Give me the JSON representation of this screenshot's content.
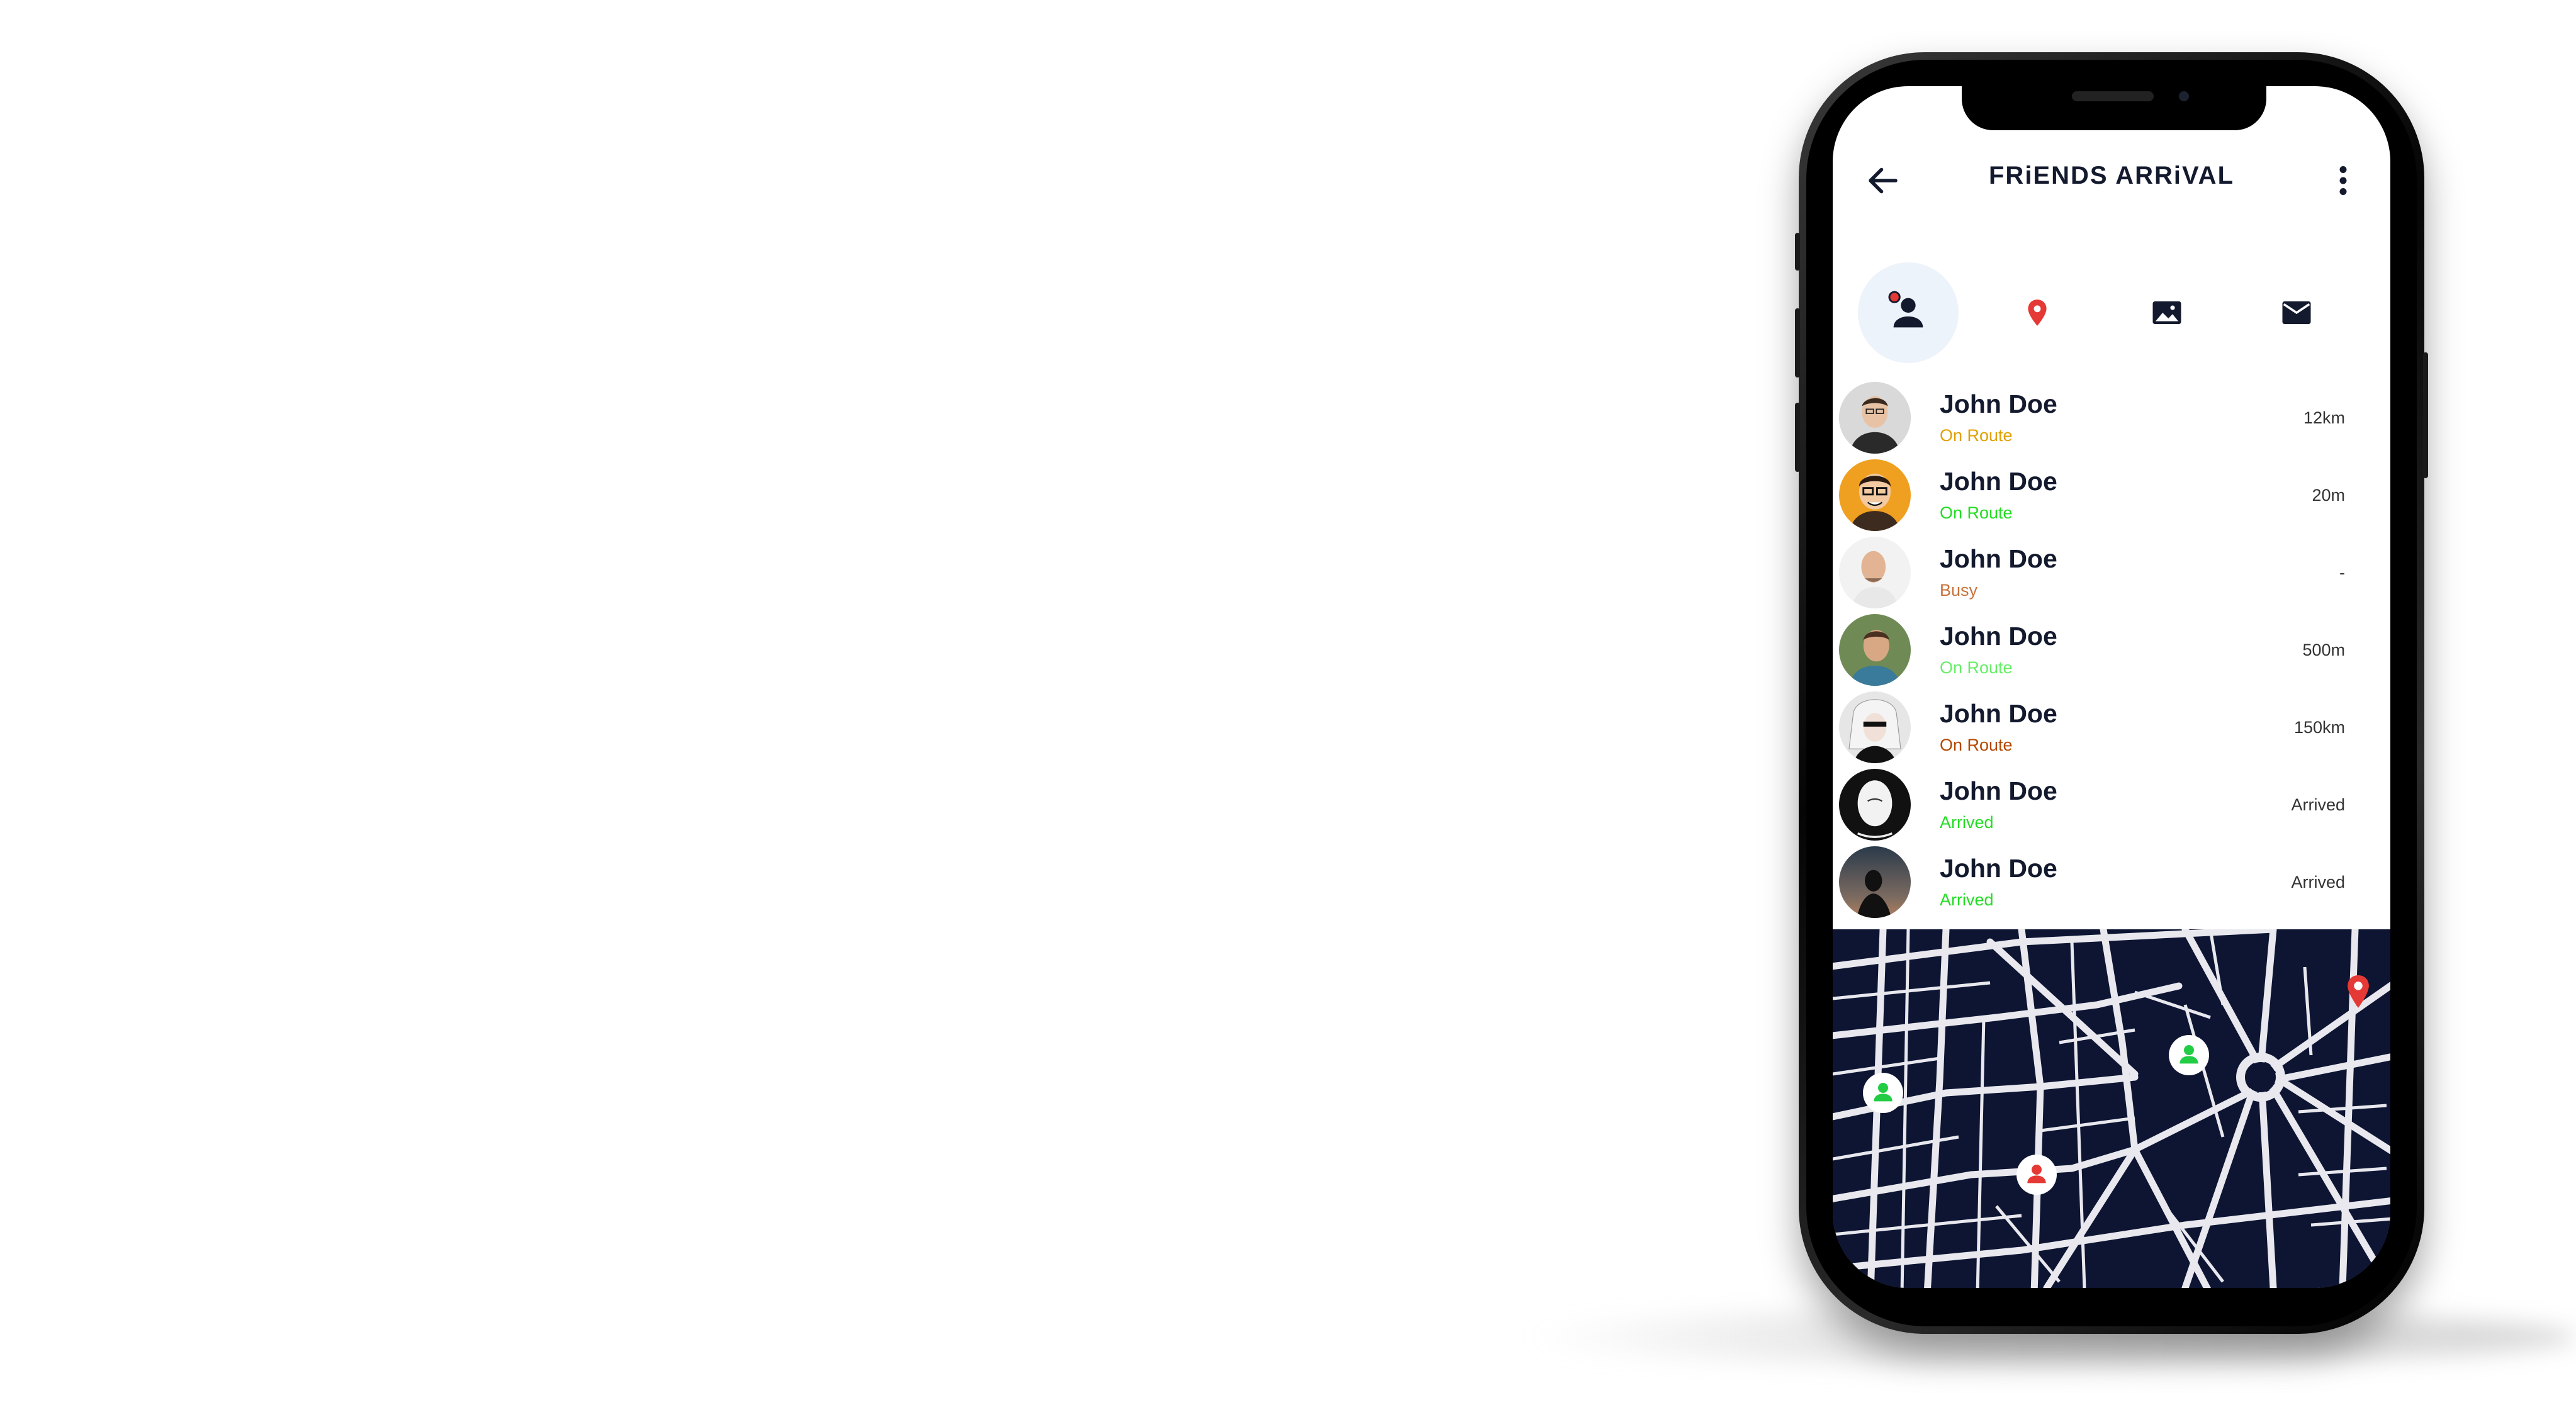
{
  "app": {
    "title": "FRiENDS ARRiVAL",
    "accent_color": "#e53935",
    "text_color": "#141a2e"
  },
  "header": {
    "back_icon": "arrow-left-icon",
    "more_icon": "more-vertical-icon"
  },
  "tabs": [
    {
      "icon": "person-icon",
      "active": true,
      "has_badge": true
    },
    {
      "icon": "location-pin-icon",
      "active": false
    },
    {
      "icon": "image-icon",
      "active": false
    },
    {
      "icon": "mail-icon",
      "active": false
    }
  ],
  "friends": [
    {
      "name": "John Doe",
      "status": "On Route",
      "status_color": "#e0a000",
      "distance": "12km"
    },
    {
      "name": "John Doe",
      "status": "On Route",
      "status_color": "#22dd22",
      "distance": "20m"
    },
    {
      "name": "John Doe",
      "status": "Busy",
      "status_color": "#c8723a",
      "distance": "-"
    },
    {
      "name": "John Doe",
      "status": "On Route",
      "status_color": "#66ee66",
      "distance": "500m"
    },
    {
      "name": "John Doe",
      "status": "On Route",
      "status_color": "#b34700",
      "distance": "150km"
    },
    {
      "name": "John Doe",
      "status": "Arrived",
      "status_color": "#22dd22",
      "distance": "Arrived"
    },
    {
      "name": "John Doe",
      "status": "Arrived",
      "status_color": "#22dd22",
      "distance": "Arrived"
    }
  ],
  "map": {
    "background_color": "#0d1533",
    "road_color": "#e8e8ee",
    "markers": [
      {
        "icon": "destination-pin-icon",
        "color": "#e53935"
      },
      {
        "icon": "friend-marker-icon",
        "color": "#22cc44"
      },
      {
        "icon": "friend-marker-icon",
        "color": "#22cc44"
      },
      {
        "icon": "friend-marker-icon",
        "color": "#e53935"
      }
    ]
  }
}
